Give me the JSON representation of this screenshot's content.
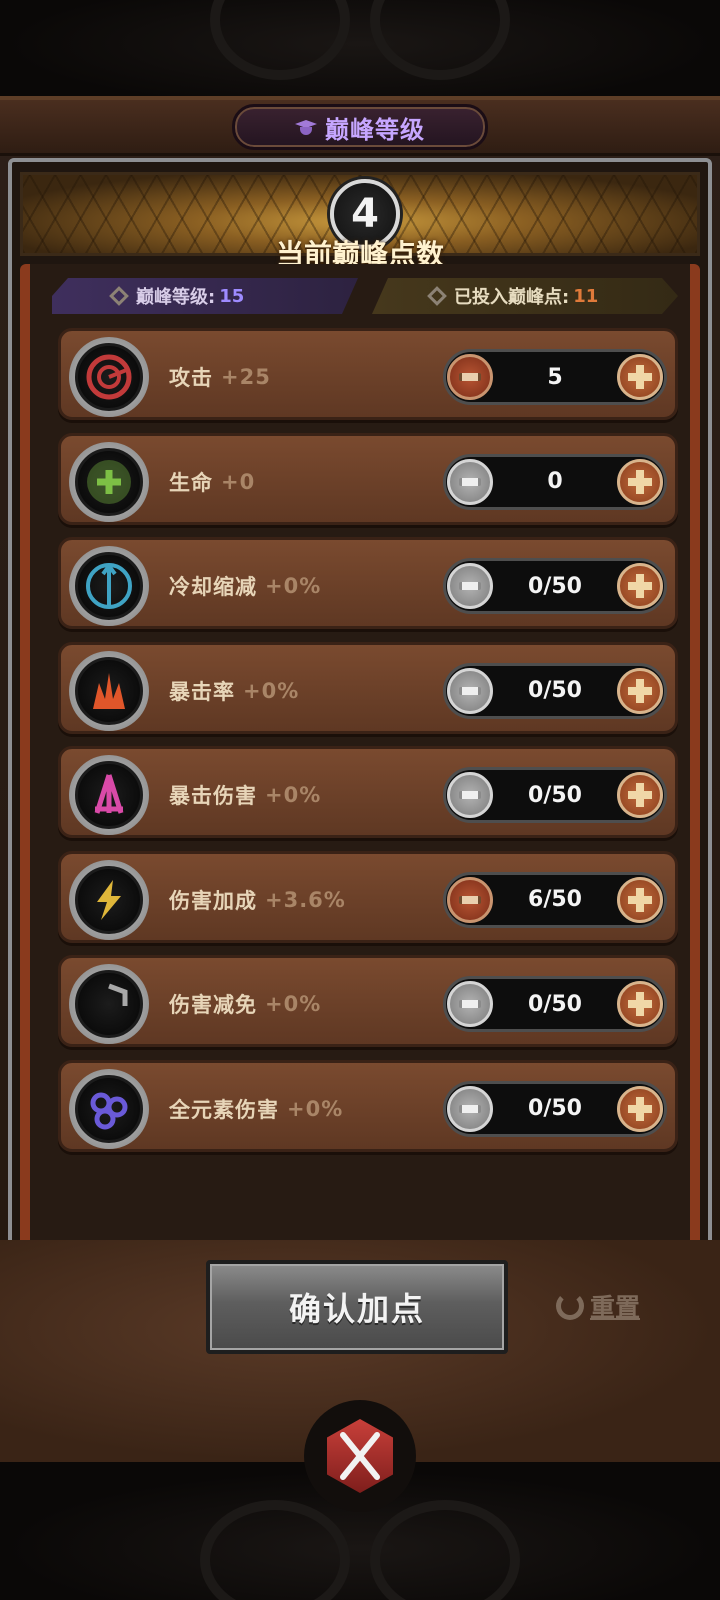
{
  "header": {
    "title": "巅峰等级"
  },
  "banner": {
    "points": "4",
    "label": "当前巅峰点数"
  },
  "info": {
    "level_label": "巅峰等级:",
    "level_value": "15",
    "invested_label": "已投入巅峰点:",
    "invested_value": "11"
  },
  "stats": [
    {
      "name": "攻击",
      "bonus": "+25",
      "value": "5",
      "icon": "attack-target-icon",
      "minus_state": "active",
      "color": "#c23a3a"
    },
    {
      "name": "生命",
      "bonus": "+0",
      "value": "0",
      "icon": "life-cross-icon",
      "minus_state": "disabled",
      "color": "#7dbf45"
    },
    {
      "name": "冷却缩减",
      "bonus": "+0%",
      "value": "0/50",
      "icon": "cooldown-clock-icon",
      "minus_state": "disabled",
      "color": "#3fa3c4"
    },
    {
      "name": "暴击率",
      "bonus": "+0%",
      "value": "0/50",
      "icon": "crit-rate-flame-icon",
      "minus_state": "disabled",
      "color": "#e0562a"
    },
    {
      "name": "暴击伤害",
      "bonus": "+0%",
      "value": "0/50",
      "icon": "crit-damage-arrows-icon",
      "minus_state": "disabled",
      "color": "#d94aa8"
    },
    {
      "name": "伤害加成",
      "bonus": "+3.6%",
      "value": "6/50",
      "icon": "damage-bonus-lightning-icon",
      "minus_state": "active",
      "color": "#e0b73a"
    },
    {
      "name": "伤害减免",
      "bonus": "+0%",
      "value": "0/50",
      "icon": "damage-reduction-shield-icon",
      "minus_state": "disabled",
      "color": "#a8a8a8"
    },
    {
      "name": "全元素伤害",
      "bonus": "+0%",
      "value": "0/50",
      "icon": "elemental-orbs-icon",
      "minus_state": "disabled",
      "color": "#6a5ad8"
    }
  ],
  "actions": {
    "confirm_label": "确认加点",
    "reset_label": "重置"
  },
  "colors": {
    "accent_purple": "#9e8bff",
    "accent_orange": "#e07a3a",
    "title_purple": "#c6a6ff"
  }
}
